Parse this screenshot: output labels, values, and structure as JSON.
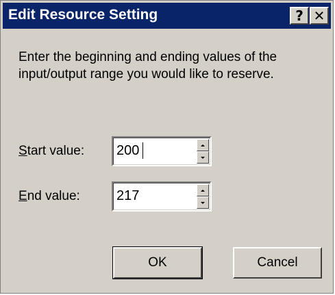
{
  "window": {
    "title": "Edit Resource Setting",
    "help_label": "?",
    "close_label": "✕"
  },
  "instructions": "Enter the beginning and ending values of the input/output range you would like to reserve.",
  "start_field": {
    "label_mnemonic": "S",
    "label_rest": "tart value:",
    "value": "200"
  },
  "end_field": {
    "label_mnemonic": "E",
    "label_rest": "nd value:",
    "value": "217"
  },
  "buttons": {
    "ok_label": "OK",
    "cancel_label": "Cancel"
  },
  "colors": {
    "title_bar": "#0a246a",
    "dialog_face": "#d4d0c8"
  }
}
